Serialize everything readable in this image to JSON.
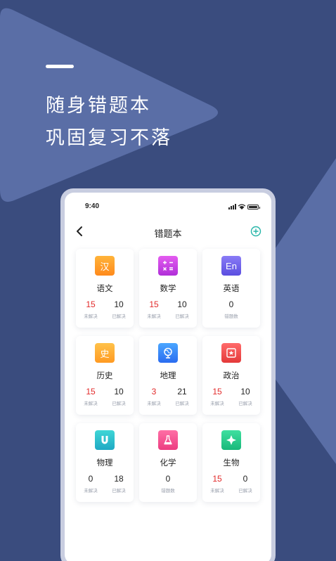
{
  "promo": {
    "line1": "随身错题本",
    "line2": "巩固复习不落"
  },
  "phone": {
    "status_time": "9:40",
    "title": "错题本"
  },
  "colors": {
    "background": "#3a4c7e",
    "unsolved_red": "#e22a2a",
    "add_teal": "#26b5a8"
  },
  "subjects": [
    {
      "name": "语文",
      "icon": "chinese-icon",
      "glyph": "汉",
      "stats": [
        {
          "value": "15",
          "label": "未解决",
          "red": true
        },
        {
          "value": "10",
          "label": "已解决"
        }
      ]
    },
    {
      "name": "数学",
      "icon": "math-icon",
      "glyph": "",
      "stats": [
        {
          "value": "15",
          "label": "未解决",
          "red": true
        },
        {
          "value": "10",
          "label": "已解决"
        }
      ]
    },
    {
      "name": "英语",
      "icon": "english-icon",
      "glyph": "En",
      "stats": [
        {
          "value": "0",
          "label": "错题数"
        }
      ]
    },
    {
      "name": "历史",
      "icon": "history-icon",
      "glyph": "史",
      "stats": [
        {
          "value": "15",
          "label": "未解决",
          "red": true
        },
        {
          "value": "10",
          "label": "已解决"
        }
      ]
    },
    {
      "name": "地理",
      "icon": "globe-icon",
      "glyph": "",
      "stats": [
        {
          "value": "3",
          "label": "未解决",
          "red": true
        },
        {
          "value": "21",
          "label": "已解决"
        }
      ]
    },
    {
      "name": "政治",
      "icon": "politics-icon",
      "glyph": "",
      "stats": [
        {
          "value": "15",
          "label": "未解决",
          "red": true
        },
        {
          "value": "10",
          "label": "已解决"
        }
      ]
    },
    {
      "name": "物理",
      "icon": "magnet-icon",
      "glyph": "",
      "stats": [
        {
          "value": "0",
          "label": "未解决"
        },
        {
          "value": "18",
          "label": "已解决"
        }
      ]
    },
    {
      "name": "化学",
      "icon": "flask-icon",
      "glyph": "",
      "stats": [
        {
          "value": "0",
          "label": "错题数"
        }
      ]
    },
    {
      "name": "生物",
      "icon": "biology-icon",
      "glyph": "",
      "stats": [
        {
          "value": "15",
          "label": "未解决",
          "red": true
        },
        {
          "value": "0",
          "label": "已解决"
        }
      ]
    }
  ]
}
